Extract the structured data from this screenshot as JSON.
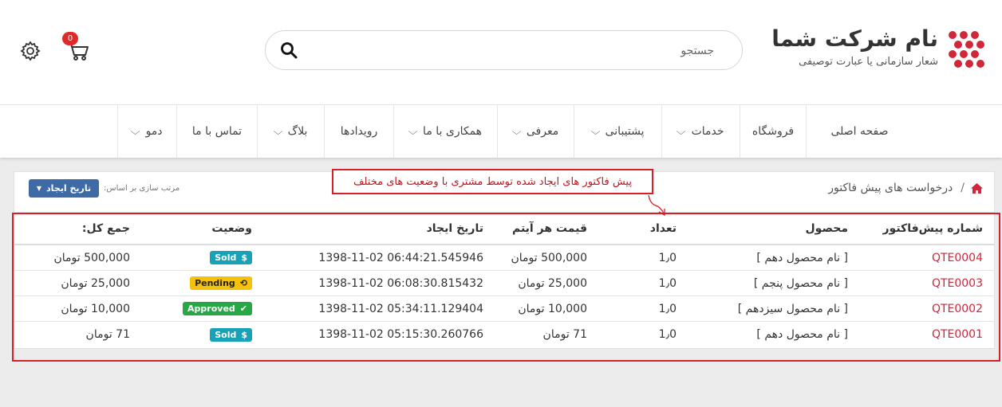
{
  "header": {
    "cart_count": "0",
    "search": {
      "placeholder": "جستجو"
    },
    "logo": {
      "title": "نام شرکت شما",
      "subtitle": "شعار سازمانی یا عبارت توصیفی"
    }
  },
  "nav": {
    "items": [
      {
        "label": "صفحه اصلی",
        "dropdown": false
      },
      {
        "label": "فروشگاه",
        "dropdown": false
      },
      {
        "label": "خدمات",
        "dropdown": true
      },
      {
        "label": "پشتیبانی",
        "dropdown": true
      },
      {
        "label": "معرفی",
        "dropdown": true
      },
      {
        "label": "همکاری با ما",
        "dropdown": true
      },
      {
        "label": "رویدادها",
        "dropdown": false
      },
      {
        "label": "بلاگ",
        "dropdown": true
      },
      {
        "label": "تماس با ما",
        "dropdown": false
      },
      {
        "label": "دمو",
        "dropdown": true
      }
    ]
  },
  "breadcrumb": {
    "current": "درخواست های پیش فاکتور",
    "separator": "/"
  },
  "sort": {
    "label": "مرتب سازی بر اساس:",
    "button": "تاریخ ایجاد"
  },
  "annotation": {
    "text": "پیش فاکتور های ایجاد شده توسط مشتری با وضعیت های مختلف"
  },
  "table": {
    "headers": {
      "number": "شماره پیش‌فاکتور",
      "product": "محصول",
      "quantity": "تعداد",
      "unit_price": "قیمت هر آیتم",
      "created": "تاریخ ایجاد",
      "status": "وضعیت",
      "total": "جمع کل:"
    },
    "rows": [
      {
        "number": "QTE0004",
        "product": "[ نام محصول دهم ]",
        "quantity": "1٫0",
        "unit_price": "500,000 تومان",
        "created": "1398-11-02 06:44:21.545946",
        "status": "Sold",
        "status_type": "sold",
        "total": "500,000 تومان"
      },
      {
        "number": "QTE0003",
        "product": "[ نام محصول پنجم ]",
        "quantity": "1٫0",
        "unit_price": "25,000 تومان",
        "created": "1398-11-02 06:08:30.815432",
        "status": "Pending",
        "status_type": "pending",
        "total": "25,000 تومان"
      },
      {
        "number": "QTE0002",
        "product": "[ نام محصول سیزدهم ]",
        "quantity": "1٫0",
        "unit_price": "10,000 تومان",
        "created": "1398-11-02 05:34:11.129404",
        "status": "Approved",
        "status_type": "approved",
        "total": "10,000 تومان"
      },
      {
        "number": "QTE0001",
        "product": "[ نام محصول دهم ]",
        "quantity": "1٫0",
        "unit_price": "71 تومان",
        "created": "1398-11-02 05:15:30.260766",
        "status": "Sold",
        "status_type": "sold",
        "total": "71 تومان"
      }
    ]
  },
  "colors": {
    "accent": "#d0273a",
    "sort_button": "#3e6aa5",
    "sold": "#17a2b8",
    "pending": "#f4c20d",
    "approved": "#28a745",
    "annotation": "#d91e2a"
  }
}
